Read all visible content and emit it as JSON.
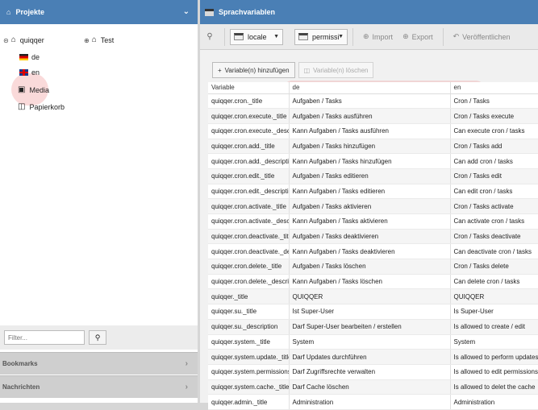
{
  "projects": {
    "title": "Projekte",
    "tree": [
      {
        "label": "quiqqer",
        "children": [
          "de",
          "en"
        ]
      },
      {
        "label": "Test"
      },
      {
        "label": "Media"
      },
      {
        "label": "Papierkorb"
      }
    ],
    "filter_placeholder": "Filter..."
  },
  "sidebar_sections": [
    "Bookmarks",
    "Nachrichten"
  ],
  "main": {
    "title": "Sprachvariablen",
    "toolbar": {
      "group_value": "locale",
      "permission_value": "permissi",
      "import_label": "Import",
      "export_label": "Export",
      "publish_label": "Veröffentlichen"
    },
    "actions": {
      "add_label": "Variable(n) hinzufügen",
      "delete_label": "Variable(n) löschen"
    },
    "table": {
      "columns": [
        "Variable",
        "de",
        "en"
      ],
      "rows": [
        [
          "quiqqer.cron._title",
          "Aufgaben / Tasks",
          "Cron / Tasks"
        ],
        [
          "quiqqer.cron.execute._title",
          "Aufgaben / Tasks ausführen",
          "Cron / Tasks execute"
        ],
        [
          "quiqqer.cron.execute._description",
          "Kann Aufgaben / Tasks ausführen",
          "Can execute cron / tasks"
        ],
        [
          "quiqqer.cron.add._title",
          "Aufgaben / Tasks hinzufügen",
          "Cron / Tasks add"
        ],
        [
          "quiqqer.cron.add._description",
          "Kann Aufgaben / Tasks hinzufügen",
          "Can add cron / tasks"
        ],
        [
          "quiqqer.cron.edit._title",
          "Aufgaben / Tasks editieren",
          "Cron / Tasks edit"
        ],
        [
          "quiqqer.cron.edit._description",
          "Kann Aufgaben / Tasks editieren",
          "Can edit cron / tasks"
        ],
        [
          "quiqqer.cron.activate._title",
          "Aufgaben / Tasks aktivieren",
          "Cron / Tasks activate"
        ],
        [
          "quiqqer.cron.activate._description",
          "Kann Aufgaben / Tasks aktivieren",
          "Can activate cron / tasks"
        ],
        [
          "quiqqer.cron.deactivate._title",
          "Aufgaben / Tasks deaktivieren",
          "Cron / Tasks deactivate"
        ],
        [
          "quiqqer.cron.deactivate._description",
          "Kann Aufgaben / Tasks deaktivieren",
          "Can deactivate cron / tasks"
        ],
        [
          "quiqqer.cron.delete._title",
          "Aufgaben / Tasks löschen",
          "Cron / Tasks delete"
        ],
        [
          "quiqqer.cron.delete._description",
          "Kann Aufgaben / Tasks löschen",
          "Can delete cron / tasks"
        ],
        [
          "quiqqer._title",
          "QUIQQER",
          "QUIQQER"
        ],
        [
          "quiqqer.su._title",
          "Ist Super-User",
          "Is Super-User"
        ],
        [
          "quiqqer.su._description",
          "Darf Super-User bearbeiten / erstellen",
          "Is allowed to create / edit"
        ],
        [
          "quiqqer.system._title",
          "System",
          "System"
        ],
        [
          "quiqqer.system.update._title",
          "Darf Updates durchführen",
          "Is allowed to perform updates"
        ],
        [
          "quiqqer.system.permissions._title",
          "Darf Zugriffsrechte verwalten",
          "Is allowed to edit permissions"
        ],
        [
          "quiqqer.system.cache._title",
          "Darf Cache löschen",
          "Is allowed to delet the cache"
        ],
        [
          "quiqqer.admin._title",
          "Administration",
          "Administration"
        ]
      ]
    }
  }
}
